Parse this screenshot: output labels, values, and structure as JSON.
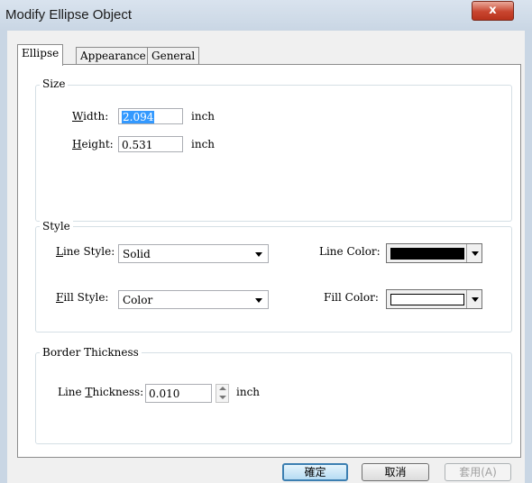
{
  "window": {
    "title": "Modify Ellipse Object",
    "close_glyph": "x"
  },
  "tabs": [
    {
      "label": "Ellipse",
      "active": true
    },
    {
      "label": "Appearance",
      "active": false
    },
    {
      "label": "General",
      "active": false
    }
  ],
  "size": {
    "legend": "Size",
    "width_label": "Width:",
    "width_value": "2.094",
    "width_unit": "inch",
    "height_label": "Height:",
    "height_value": "0.531",
    "height_unit": "inch"
  },
  "style": {
    "legend": "Style",
    "line_style_label": "Line Style:",
    "line_style_value": "Solid",
    "fill_style_label": "Fill Style:",
    "fill_style_value": "Color",
    "line_color_label": "Line Color:",
    "line_color": "#000000",
    "fill_color_label": "Fill Color:",
    "fill_color": "#ffffff"
  },
  "border": {
    "legend": "Border Thickness",
    "thickness_label": "Line Thickness:",
    "thickness_value": "0.010",
    "thickness_unit": "inch"
  },
  "buttons": {
    "ok": "確定",
    "cancel": "取消",
    "apply": "套用(A)"
  }
}
